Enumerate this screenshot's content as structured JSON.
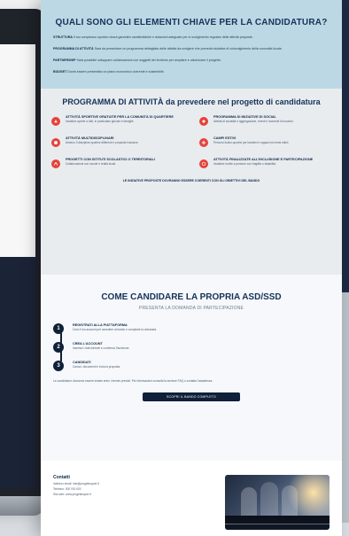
{
  "hero": {
    "title": "QUALI SONO GLI ELEMENTI CHIAVE PER LA CANDIDATURA?",
    "paragraphs": [
      {
        "label": "STRUTTURA",
        "text": "Il tuo complesso sportivo dovrà garantire caratteristiche e dotazioni adeguate per lo svolgimento regolare delle attività proposte."
      },
      {
        "label": "PROGRAMMA DI ATTIVITÀ",
        "text": "Sarà da presentare un programma dettagliato delle attività da svolgere che preveda iniziative di coinvolgimento della comunità locale."
      },
      {
        "label": "PARTNERSHIP",
        "text": "Sarà possibile sviluppare collaborazioni con soggetti del territorio per ampliare e valorizzare il progetto."
      },
      {
        "label": "BUDGET",
        "text": "Dovrà essere presentato un piano economico coerente e sostenibile."
      }
    ]
  },
  "program": {
    "title": "PROGRAMMA DI ATTIVITÀ da prevedere nel progetto di candidatura",
    "items": [
      {
        "title": "ATTIVITÀ SPORTIVE GRATUITE PER LA COMUNITÀ DI QUARTIERE",
        "desc": "Iniziative aperte a tutti, in particolare giovani e famiglie."
      },
      {
        "title": "PROGRAMMA DI INIZIATIVE DI SOCIAL",
        "desc": "Attività di socialità e aggregazione, eventi e momenti di incontro."
      },
      {
        "title": "ATTIVITÀ MULTIDISCIPLINARI",
        "desc": "Almeno 3 discipline sportive differenti e proposte inclusive."
      },
      {
        "title": "CAMPI ESTIVI",
        "desc": "Percorsi ludico-sportivi per bambini e ragazzi nei mesi estivi."
      },
      {
        "title": "PROGETTI CON ISTITUTI SCOLASTICI O TERRITORIALI",
        "desc": "Collaborazioni con scuole e realtà locali."
      },
      {
        "title": "ATTIVITÀ FINALIZZATE ALL’INCLUSIONE E PARTECIPAZIONE",
        "desc": "Iniziative rivolte a persone con fragilità o disabilità."
      }
    ],
    "footnote": "LE INIZIATIVE PROPOSTE DOVRANNO ESSERE COERENTI CON GLI OBIETTIVI DEL BANDO"
  },
  "apply": {
    "title": "COME CANDIDARE LA PROPRIA ASD/SSD",
    "subtitle": "PRESENTA LA DOMANDA DI PARTECIPAZIONE",
    "steps": [
      {
        "n": "1",
        "title": "REGISTRATI ALLA PIATTAFORMA",
        "text": "Crea il tuo account per accedere al bando e compilare la domanda."
      },
      {
        "n": "2",
        "title": "CREA L’ACCOUNT",
        "text": "Inserisci i dati richiesti e conferma l’iscrizione."
      },
      {
        "n": "3",
        "title": "CANDIDATI",
        "text": "Carica i documenti e invia la proposta."
      }
    ],
    "note": "Le candidature dovranno essere inviate entro i termini previsti. Per informazioni consulta la sezione FAQ o contatta l’assistenza.",
    "button": "SCOPRI IL BANDO COMPLETO"
  },
  "footer": {
    "contacts_title": "Contatti",
    "lines": [
      "Indirizzo email: info@progettosport.it",
      "Telefono: 000 000 000",
      "Sito web: www.progettosport.it"
    ]
  }
}
